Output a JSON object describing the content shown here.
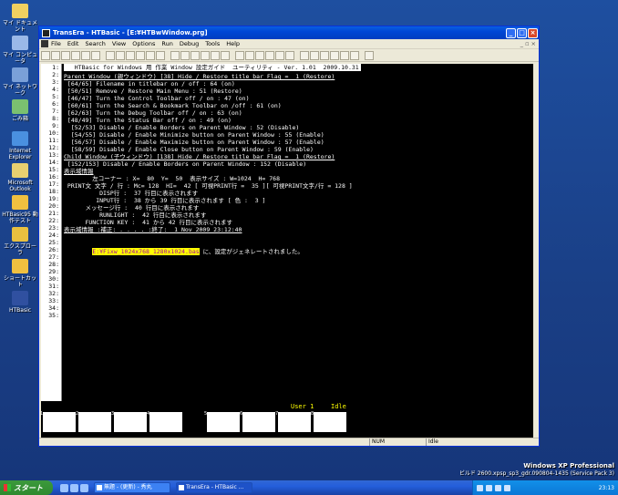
{
  "desktop": {
    "icons": [
      {
        "label": "マイ ドキュメント",
        "color": "#f0d060"
      },
      {
        "label": "マイ コンピュータ",
        "color": "#9ab8e8"
      },
      {
        "label": "マイ ネットワーク",
        "color": "#7aa0d8"
      },
      {
        "label": "ごみ箱",
        "color": "#7ac070"
      },
      {
        "label": "Internet Explorer",
        "color": "#4a90e0"
      },
      {
        "label": "Microsoft Outlook",
        "color": "#e8d070"
      },
      {
        "label": "HTBasic95 動作テスト",
        "color": "#f0c040"
      },
      {
        "label": "エクスプローラ",
        "color": "#e8c040"
      },
      {
        "label": "ショートカット",
        "color": "#f0c040"
      },
      {
        "label": "HTBasic",
        "color": "#3050a0"
      }
    ],
    "brand": {
      "name": "Windows XP Professional",
      "build": "ビルド 2600.xpsp_sp3_gdr.090804-1435 (Service Pack 3)"
    }
  },
  "window": {
    "title": "TransEra - HTBasic - [E:¥HTBwWindow.prg]",
    "menu": [
      "File",
      "Edit",
      "Search",
      "View",
      "Options",
      "Run",
      "Debug",
      "Tools",
      "Help"
    ],
    "mdi_controls": "_ ▫ ×"
  },
  "editor": {
    "lines": [
      "   HTBasic for Windows 用 作業 Window 設定ガイド  ユーティリティ - Ver. 1.01  2009.10.31",
      "Parent Window (親ウィンドウ) [38] Hide / Restore title bar Flag =  1 (Restore)",
      " [64/65] Filename in titlebar on / off : 64 (on)",
      " [50/51] Remove / Restore Main Menu : 51 (Restore)",
      " [46/47] Turn the Control Toolbar off / on : 47 (on)",
      " [60/61] Turn the Search & Bookmark Toolbar on /off : 61 (on)",
      " [62/63] Turn the Debug Toolbar off / on : 63 (on)",
      " [48/49] Turn the Status Bar off / on : 49 (on)",
      "  [52/53] Disable / Enable Borders on Parent Window : 52 (Disable)",
      "  [54/55] Disable / Enable Minimize button on Parent Window : 55 (Enable)",
      "  [56/57] Disable / Enable Maximize button on Parent Window : 57 (Enable)",
      "  [58/59] Disable / Enable Close button on Parent Window : 59 (Enable)",
      "Child Window (子ウィンドウ) [138] Hide / Restore title bar Flag =  1 (Restore)",
      " [152/153] Disable / Enable Borders on Parent Window : 152 (Disable)",
      "表示域情報",
      "        左コーナー : X=  80  Y=  50  表示サイズ : W=1024  H= 768",
      " PRINT文 文字 / 行 : Mc= 128  HI=  42 [ 可視PRINT行 =  35 ][ 可視PRINT文字/行 = 128 ]",
      "          DISP行 :  37 行目に表示されます",
      "         INPUT行 :  38 から 39 行目に表示されます [ 色 :  3 ]",
      "      メッセージ行 :  40 行目に表示されます",
      "          RUNLIGHT :  42 行目に表示されます",
      "      FUNCTION KEY :  41 から 42 行目に表示されます",
      "表示域情報 :補正: . . . . :終了:  1 Nov 2009 23:12:40",
      "",
      "",
      "        E:¥Fixw_1024x768_1280x1024.bas に、設定がジェネレートされました。",
      "",
      "",
      "",
      "",
      "",
      "",
      "",
      "",
      ""
    ],
    "generated_file": "E:¥Fixw_1024x768_1280x1024.bas",
    "generated_msg": " に、設定がジェネレートされました。"
  },
  "runtime": {
    "state": "User 1",
    "status": "Idle",
    "fkeys": [
      "1",
      "2",
      "3",
      "4",
      "5",
      "6",
      "7",
      "8"
    ]
  },
  "statusbar": {
    "num": "NUM",
    "idle": "Idle"
  },
  "taskbar": {
    "start": "スタート",
    "tasks": [
      "無題 - (更新) - 秀丸",
      "TransEra - HTBasic ..."
    ],
    "clock": "23:13"
  }
}
